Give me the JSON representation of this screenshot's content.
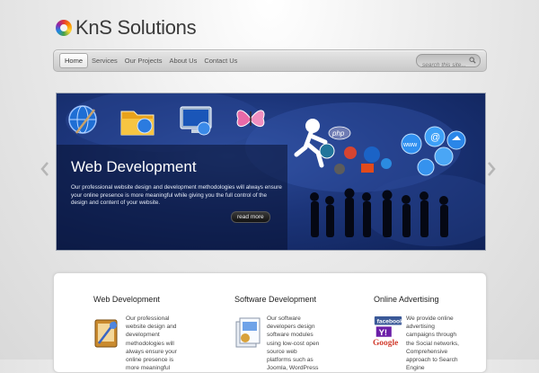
{
  "brand": {
    "name": "KnS Solutions"
  },
  "nav": {
    "items": [
      {
        "label": "Home",
        "active": true
      },
      {
        "label": "Services",
        "active": false
      },
      {
        "label": "Our Projects",
        "active": false
      },
      {
        "label": "About Us",
        "active": false
      },
      {
        "label": "Contact Us",
        "active": false
      }
    ],
    "search_placeholder": "search this site..."
  },
  "slider": {
    "title": "Web Development",
    "description": "Our professional website design and development methodologies will always ensure your online presence is more meaningful while giving you the full control of the design and content of your website.",
    "button_label": "read more",
    "icons": [
      "globe-icon",
      "folder-icon",
      "monitor-icon",
      "butterfly-icon"
    ],
    "tech_labels": [
      "php",
      "www"
    ]
  },
  "features": [
    {
      "title": "Web Development",
      "text": "Our professional website design and development methodologies will always ensure your online presence is more meaningful",
      "icon": "design-tools-icon"
    },
    {
      "title": "Software Development",
      "text": "Our software developers design software modules using low-cost open source web platforms such as Joomla, WordPress",
      "icon": "software-box-icon"
    },
    {
      "title": "Online Advertising",
      "text": "We provide online advertising campaigns through the Social networks, Comprehensive approach to Search Engine",
      "icon": "social-logos-icon",
      "logo_text": [
        "facebook",
        "Y!",
        "Google"
      ]
    }
  ],
  "colors": {
    "slider_bg": "#1c357a",
    "nav_bg": "#d6d6d6",
    "panel_bg": "#ffffff"
  }
}
